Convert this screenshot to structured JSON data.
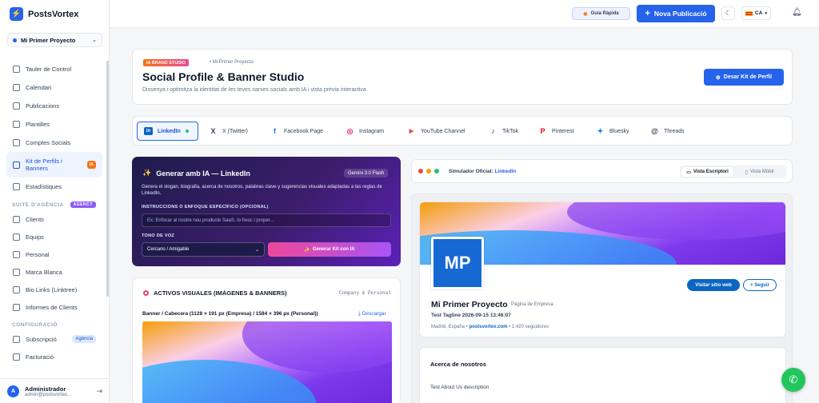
{
  "app": {
    "name": "PostsVortex",
    "logo_icon": "lightning-icon"
  },
  "sidebar": {
    "project": "Mi Primer Proyecto",
    "items": [
      {
        "label": "Tauler de Control",
        "icon": "grid-icon"
      },
      {
        "label": "Calendari",
        "icon": "calendar-icon"
      },
      {
        "label": "Publicacions",
        "icon": "document-icon"
      },
      {
        "label": "Plantilles",
        "icon": "template-icon"
      },
      {
        "label": "Comptes Socials",
        "icon": "link-icon"
      },
      {
        "label": "Kit de Perfils i Banners",
        "icon": "sparkle-icon",
        "badge": "IA",
        "active": true
      },
      {
        "label": "Estadístiques",
        "icon": "chart-icon"
      }
    ],
    "agency_section": {
      "label": "SUITE D'AGÈNCIA",
      "badge": "AGENCY"
    },
    "agency_items": [
      {
        "label": "Clients",
        "icon": "clients-icon"
      },
      {
        "label": "Equips",
        "icon": "teams-icon"
      },
      {
        "label": "Personal",
        "icon": "person-icon"
      },
      {
        "label": "Marca Blanca",
        "icon": "brand-icon"
      },
      {
        "label": "Bio Links (Linktree)",
        "icon": "link-icon"
      },
      {
        "label": "Informes de Clients",
        "icon": "report-icon"
      }
    ],
    "config_section": {
      "label": "CONFIGURACIÓ"
    },
    "config_items": [
      {
        "label": "Subscripció",
        "badge": "Agència",
        "icon": "card-icon"
      },
      {
        "label": "Facturació",
        "icon": "invoice-icon"
      }
    ],
    "user": {
      "initial": "A",
      "name": "Administrador",
      "email": "admin@postsvortex..."
    }
  },
  "topbar": {
    "guide": "Guia Ràpida",
    "new_post": "Nova Publicació",
    "lang": "CA",
    "colors": {
      "primary": "#2563eb"
    }
  },
  "header": {
    "pill": "IA BRAND STUDIO",
    "crumb": "• Mi Primer Proyecto",
    "title": "Social Profile & Banner Studio",
    "subtitle": "Dissenya i optimitza la identitat de les teves xarxes socials amb IA i vista prèvia interactiva",
    "download": "Desar Kit de Perfil"
  },
  "tabs": [
    {
      "label": "LinkedIn",
      "glyph": "in",
      "active": true
    },
    {
      "label": "X (Twitter)",
      "glyph": "X"
    },
    {
      "label": "Facebook Page",
      "glyph": "f"
    },
    {
      "label": "Instagram",
      "glyph": "◎"
    },
    {
      "label": "YouTube Channel",
      "glyph": "▶"
    },
    {
      "label": "TikTok",
      "glyph": "♪"
    },
    {
      "label": "Pinterest",
      "glyph": "P"
    },
    {
      "label": "Bluesky",
      "glyph": "🦋"
    },
    {
      "label": "Threads",
      "glyph": "@"
    }
  ],
  "ai": {
    "title": "Generar amb IA — LinkedIn",
    "model": "Gemini 3.0 Flash",
    "desc": "Genera el slogan, biografia, acerca de nosotros, palabras clave y sugerencias visuales adaptadas a las reglas de LinkedIn.",
    "instructions_label": "INSTRUCCIONS O ENFOQUE ESPECÍFICO (OPCIONAL)",
    "instructions_placeholder": "Ex: Enfocar al nostre nou producte SaaS, to fresc i proper...",
    "tone_label": "TONO DE VOZ",
    "tone_value": "Cercano / Amigable",
    "generate": "Generar Kit con IA"
  },
  "assets": {
    "title": "ACTIVOS VISUALES (IMÁGENES & BANNERS)",
    "meta": "Company & Personal",
    "banner_label": "Banner / Cabecera (1128 × 191 px (Empresa) / 1584 × 396 px (Personal))",
    "download": "Descargar"
  },
  "simulator": {
    "label": "Simulador Oficial:",
    "network": "LinkedIn",
    "desktop": "Vista Escriptori",
    "mobile": "Vista Mòbil"
  },
  "profile": {
    "logo_text": "MP",
    "visit": "Visitar sitio web",
    "follow": "+ Seguir",
    "name": "Mi Primer Proyecto",
    "type": "Página de Empresa",
    "tagline": "Test Tagline 2026-09-15 13:46:07",
    "location": "Madrid, España  •",
    "website": "postsvortex.com",
    "followers": "•  1.420 seguidores"
  },
  "about": {
    "title": "Acerca de nosotros",
    "desc": "Test About Us description"
  }
}
